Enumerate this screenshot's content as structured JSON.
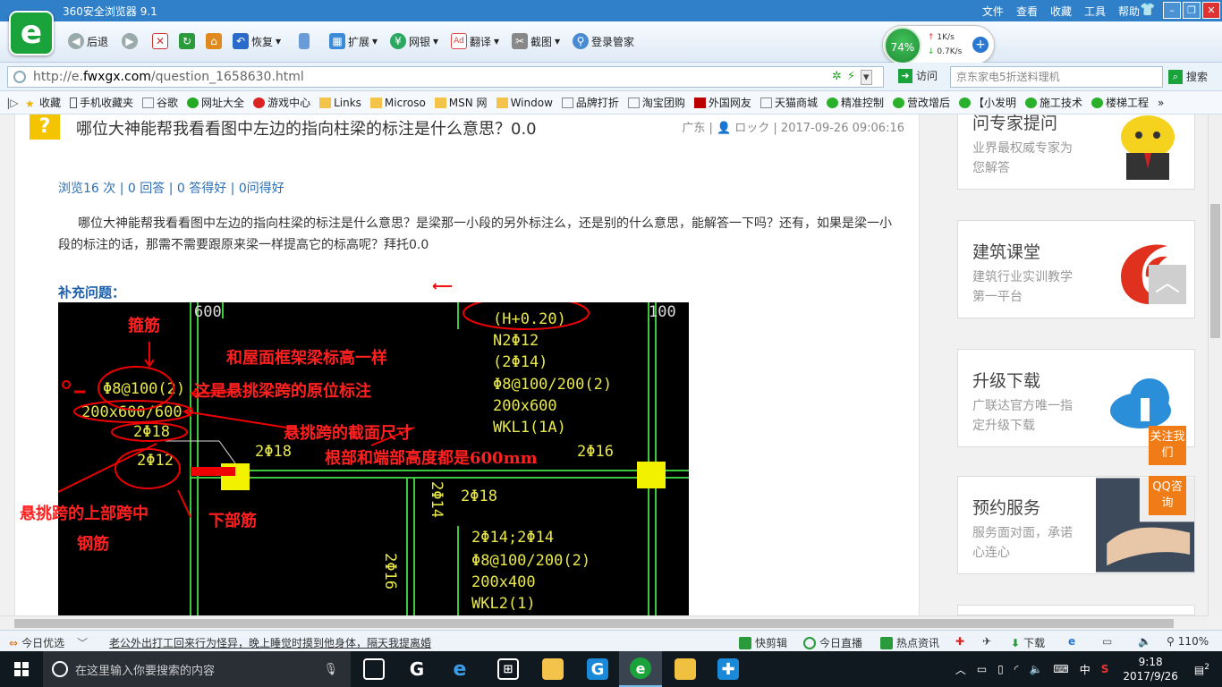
{
  "browser": {
    "title": "360安全浏览器 9.1",
    "menu": [
      "文件",
      "查看",
      "收藏",
      "工具",
      "帮助"
    ],
    "toolbar": {
      "back": "后退",
      "restore": "恢复",
      "extend": "扩展",
      "bank": "网银",
      "translate": "翻译",
      "screenshot": "截图",
      "login_manager": "登录管家"
    },
    "speed": {
      "percent": "74%",
      "up": "1K/s",
      "down": "0.7K/s"
    },
    "url": {
      "scheme": "http://e.",
      "host": "fwxgx.com",
      "path": "/question_1658630.html"
    },
    "visit_label": "访问",
    "search_placeholder": "京东家电5折送料理机",
    "search_label": "搜索",
    "bookmarks": [
      "收藏",
      "手机收藏夹",
      "谷歌",
      "网址大全",
      "游戏中心",
      "Links",
      "Microso",
      "MSN 网",
      "Window",
      "品牌打折",
      "淘宝团购",
      "外国网友",
      "天猫商城",
      "精准控制",
      "营改增后",
      "【小发明",
      "施工技术",
      "楼梯工程"
    ]
  },
  "question": {
    "badge": "?",
    "title": "哪位大神能帮我看看图中左边的指向柱梁的标注是什么意思？0.0",
    "meta": "广东 | 👤 ロック | 2017-09-26 09:06:16",
    "stats": "浏览16 次 | 0 回答 | 0 答得好 | 0问得好",
    "body": "哪位大神能帮我看看图中左边的指向柱梁的标注是什么意思？是梁那一小段的另外标注么，还是别的什么意思，能解答一下吗？还有，如果是梁一小段的标注的话，那需不需要跟原来梁一样提高它的标高呢？拜托0.0",
    "supplement_label": "补充问题："
  },
  "drawing": {
    "white_600": "600",
    "white_100": "100",
    "yellow_h": "(H+0.20)",
    "yellow_n2": "N2Φ12",
    "yellow_2p14": "(2Φ14)",
    "yellow_stirrup_r": "Φ8@100/200(2)",
    "yellow_200x600": "200x600",
    "yellow_wkl1": "WKL1(1A)",
    "yellow_stirrup_l": "Φ8@100(2)",
    "yellow_200x600_600": "200x600/600",
    "yellow_2p18_a": "2Φ18",
    "yellow_2p12": "2Φ12",
    "yellow_2p18_b": "2Φ18",
    "yellow_2p16_a": "2Φ16",
    "yellow_2p14_v": "2Φ14",
    "yellow_2p18_c": "2Φ18",
    "yellow_2p14_2p14": "2Φ14;2Φ14",
    "yellow_stirrup_b": "Φ8@100/200(2)",
    "yellow_200x400": "200x400",
    "yellow_wkl2": "WKL2(1)",
    "yellow_2p16_v": "2Φ16",
    "red_stirrup": "箍筋",
    "red_same_elev": "和屋面框架梁标高一样",
    "red_cantilever_orig": "这是悬挑梁跨的原位标注",
    "red_section": "悬挑跨的截面尺寸",
    "red_root_end": "根部和端部高度都是600mm",
    "red_top_bar_1": "悬挑跨的上部跨中",
    "red_top_bar_2": "钢筋",
    "red_bottom_bar": "下部筋"
  },
  "sidebar": [
    {
      "title": "问专家提问",
      "sub": "业界最权威专家为您解答"
    },
    {
      "title": "建筑课堂",
      "sub": "建筑行业实训教学第一平台"
    },
    {
      "title": "升级下载",
      "sub": "广联达官方唯一指定升级下载"
    },
    {
      "title": "预约服务",
      "sub": "服务面对面，承诺心连心"
    }
  ],
  "float": {
    "follow": "关注我们",
    "qq": "QQ咨询"
  },
  "statusbar": {
    "today_pick": "今日优选",
    "headline": "老公外出打工回来行为怪异，晚上睡觉时摸到他身体，隔天我提离婚",
    "quick_edit": "快剪辑",
    "live": "今日直播",
    "hot_news": "热点资讯",
    "download": "下载",
    "zoom": "110%"
  },
  "taskbar": {
    "search_placeholder": "在这里输入你要搜索的内容",
    "ime": "中",
    "time": "9:18",
    "date": "2017/9/26",
    "notifications": "2"
  }
}
